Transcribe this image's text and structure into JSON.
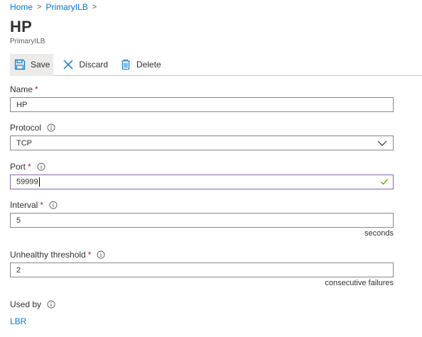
{
  "breadcrumb": {
    "items": [
      "Home",
      "PrimaryILB"
    ],
    "separator": ">"
  },
  "header": {
    "title": "HP",
    "subtitle": "PrimaryILB"
  },
  "toolbar": {
    "save_label": "Save",
    "discard_label": "Discard",
    "delete_label": "Delete"
  },
  "form": {
    "name": {
      "label": "Name",
      "required_mark": "*",
      "value": "HP"
    },
    "protocol": {
      "label": "Protocol",
      "value": "TCP"
    },
    "port": {
      "label": "Port",
      "required_mark": "*",
      "value": "59999"
    },
    "interval": {
      "label": "Interval",
      "required_mark": "*",
      "value": "5",
      "unit": "seconds"
    },
    "unhealthy_threshold": {
      "label": "Unhealthy threshold",
      "required_mark": "*",
      "value": "2",
      "unit": "consecutive failures"
    },
    "used_by": {
      "label": "Used by",
      "value": "LBR"
    }
  },
  "colors": {
    "link": "#0078d4",
    "required": "#a4262c",
    "focus_border": "#8764b8",
    "valid_check": "#57a300"
  }
}
